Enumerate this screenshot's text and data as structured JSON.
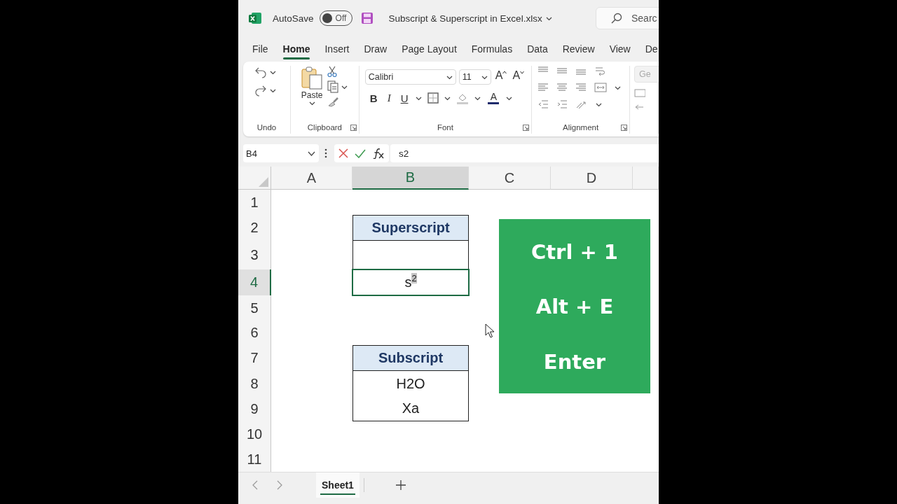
{
  "title_bar": {
    "autosave_label": "AutoSave",
    "autosave": {
      "on": false,
      "label": "Off"
    },
    "filename": "Subscript & Superscript in Excel.xlsx",
    "search_placeholder": "Searc"
  },
  "ribbon_tabs": [
    {
      "label": "File",
      "selected": false
    },
    {
      "label": "Home",
      "selected": true
    },
    {
      "label": "Insert",
      "selected": false
    },
    {
      "label": "Draw",
      "selected": false
    },
    {
      "label": "Page Layout",
      "selected": false
    },
    {
      "label": "Formulas",
      "selected": false
    },
    {
      "label": "Data",
      "selected": false
    },
    {
      "label": "Review",
      "selected": false
    },
    {
      "label": "View",
      "selected": false
    },
    {
      "label": "De",
      "selected": false
    }
  ],
  "ribbon": {
    "groups": [
      "Undo",
      "Clipboard",
      "Font",
      "Alignment"
    ],
    "paste_label": "Paste",
    "font_name": "Calibri",
    "font_size": "11",
    "grow_font": "A",
    "shrink_font": "A",
    "bold": "B",
    "italic": "I",
    "underline": "U",
    "font_color": "A",
    "number_format": "Ge"
  },
  "formula_bar": {
    "name_box": "B4",
    "formula": "s2"
  },
  "columns": [
    {
      "label": "A",
      "selected": false
    },
    {
      "label": "B",
      "selected": true
    },
    {
      "label": "C",
      "selected": false
    },
    {
      "label": "D",
      "selected": false
    }
  ],
  "rows": [
    {
      "label": "1",
      "selected": false
    },
    {
      "label": "2",
      "selected": false,
      "column_b": {
        "text": "Superscript",
        "kind": "header",
        "selected": false
      }
    },
    {
      "label": "3",
      "selected": false,
      "column_b": {
        "kind": "body",
        "selected": false
      }
    },
    {
      "label": "4",
      "selected": true,
      "column_b": {
        "text": "s$^{2}$",
        "kind": "footer",
        "selected": true
      }
    },
    {
      "label": "5",
      "selected": false
    },
    {
      "label": "6",
      "selected": false
    },
    {
      "label": "7",
      "selected": false,
      "column_b": {
        "text": "Subscript",
        "kind": "header",
        "selected": false
      }
    },
    {
      "label": "8",
      "selected": false,
      "column_b": {
        "text": "H2O",
        "kind": "body",
        "selected": false
      }
    },
    {
      "label": "9",
      "selected": false,
      "column_b": {
        "text": "Xa",
        "kind": "footer",
        "selected": false
      }
    },
    {
      "label": "10",
      "selected": false
    },
    {
      "label": "11",
      "selected": false
    }
  ],
  "shortcut_box": {
    "lines": [
      "Ctrl + 1",
      "Alt + E",
      "Enter"
    ]
  },
  "sheet_tabs": [
    {
      "label": "Sheet1",
      "selected": true
    }
  ]
}
